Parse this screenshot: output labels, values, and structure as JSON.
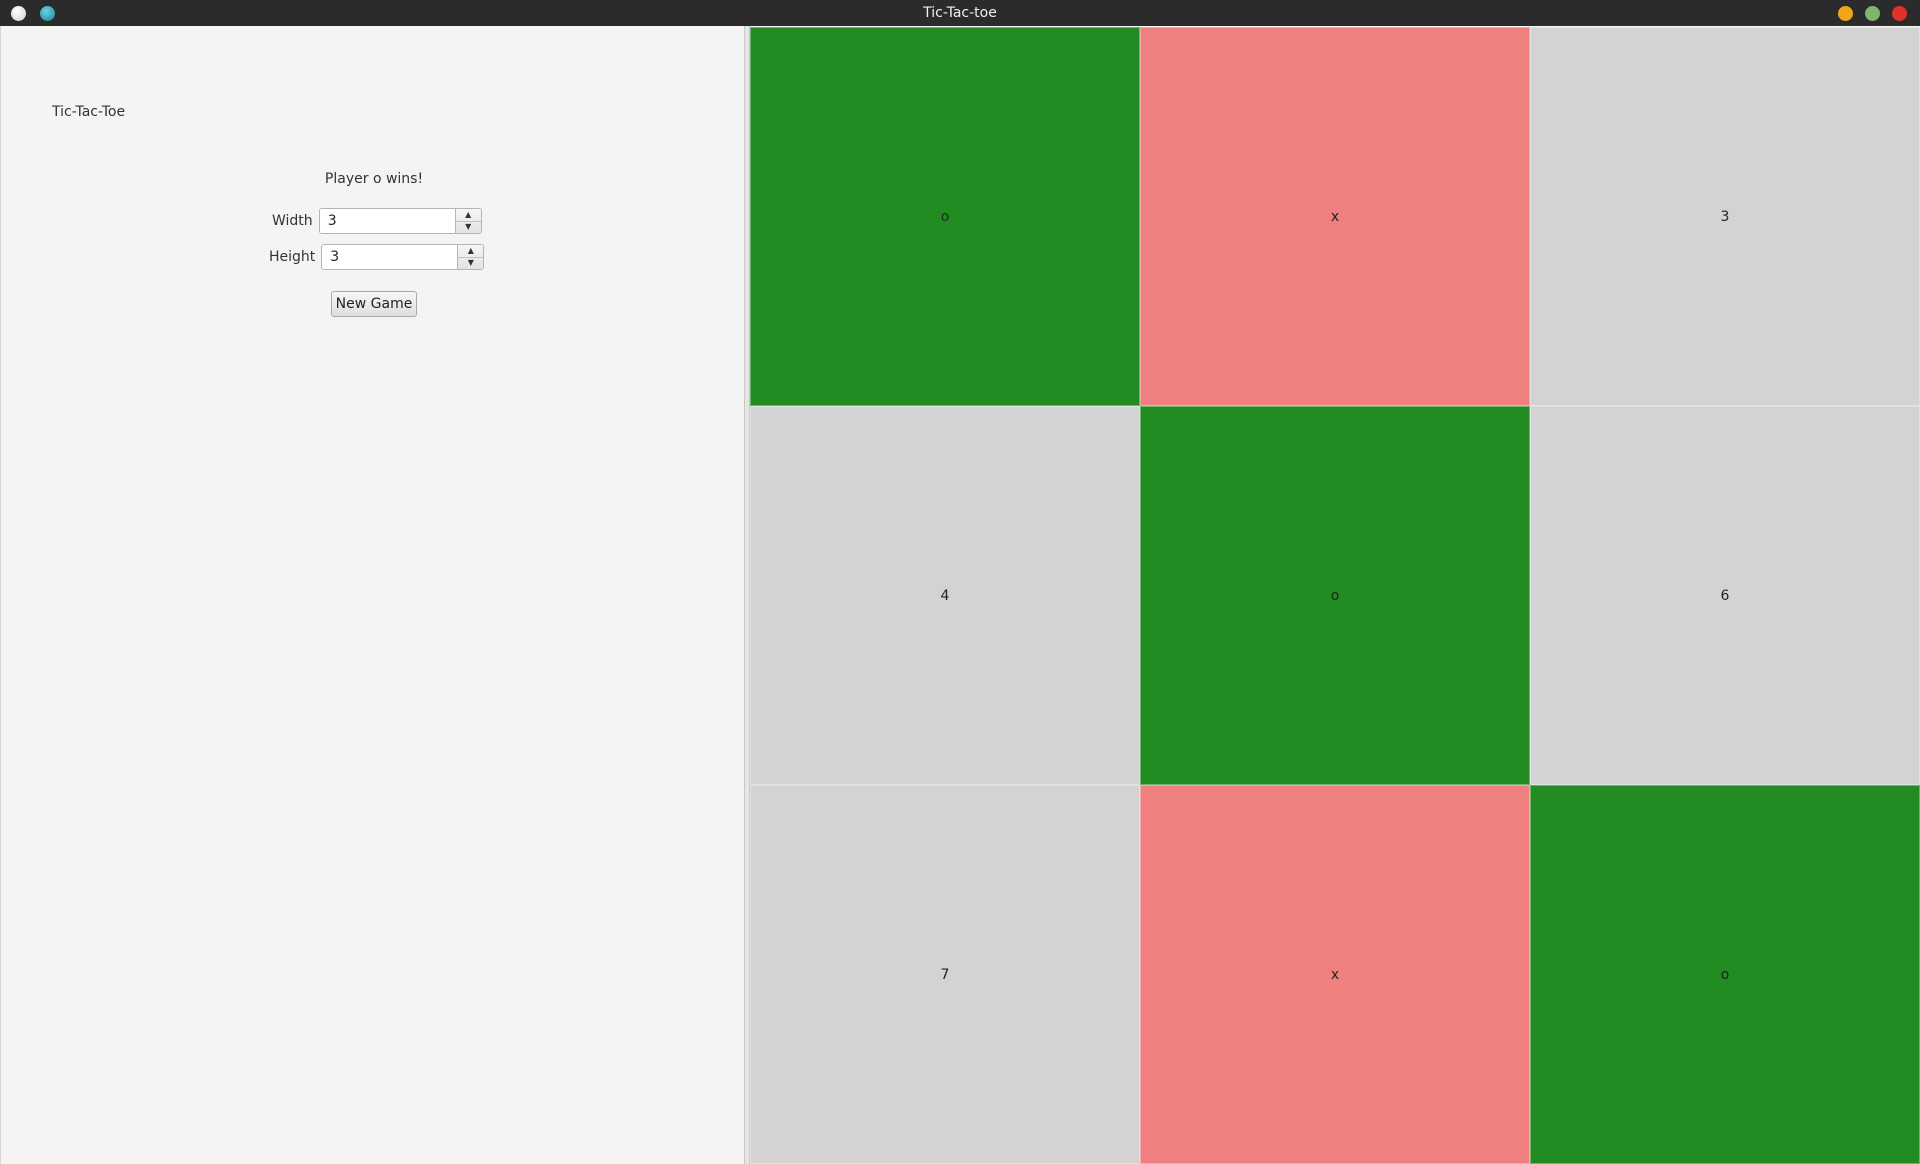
{
  "window": {
    "title": "Tic-Tac-toe"
  },
  "panel": {
    "app_label": "Tic-Tac-Toe",
    "status": "Player o wins!",
    "width_label": "Width",
    "width_value": "3",
    "height_label": "Height",
    "height_value": "3",
    "new_game_label": "New Game",
    "up_arrow": "▲",
    "down_arrow": "▼"
  },
  "colors": {
    "win": "#228B22",
    "x": "#F08080",
    "empty": "#D3D3D3"
  },
  "board": {
    "cells": [
      {
        "label": "o",
        "state": "win"
      },
      {
        "label": "x",
        "state": "x"
      },
      {
        "label": "3",
        "state": "empty"
      },
      {
        "label": "4",
        "state": "empty"
      },
      {
        "label": "o",
        "state": "win"
      },
      {
        "label": "6",
        "state": "empty"
      },
      {
        "label": "7",
        "state": "empty"
      },
      {
        "label": "x",
        "state": "x"
      },
      {
        "label": "o",
        "state": "win"
      }
    ]
  }
}
